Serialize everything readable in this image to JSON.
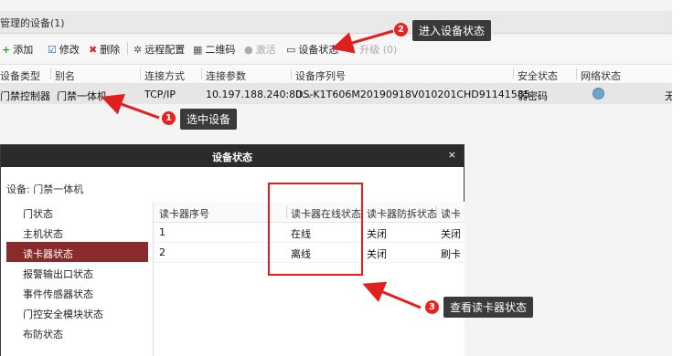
{
  "manager": {
    "title": "管理的设备(1)",
    "toolbar": [
      {
        "label": "添加",
        "icon": "plus-icon",
        "color": "#2e9e3a"
      },
      {
        "label": "修改",
        "icon": "edit-icon",
        "color": "#2a6fbf"
      },
      {
        "label": "删除",
        "icon": "delete-icon",
        "color": "#d62b2b"
      },
      {
        "label": "远程配置",
        "icon": "gear-icon",
        "color": "#555555"
      },
      {
        "label": "二维码",
        "icon": "qrcode-icon",
        "color": "#555555"
      },
      {
        "label": "激活",
        "icon": "activate-icon",
        "disabled": true
      },
      {
        "label": "设备状态",
        "icon": "device-status-icon",
        "color": "#333333"
      },
      {
        "label": "升级 (0)",
        "icon": "upgrade-icon",
        "disabled": true
      }
    ],
    "columns": [
      "设备类型",
      "别名",
      "连接方式",
      "连接参数",
      "设备序列号",
      "安全状态",
      "网络状态"
    ],
    "row": {
      "device_type": "门禁控制器",
      "alias": "门禁一体机",
      "connection": "TCP/IP",
      "params": "10.197.188.240:80...",
      "serial": "DS-K1T606M20190918V010201CHD91141585",
      "security": "弱密码",
      "network_icon": "globe-icon",
      "extra": "无"
    }
  },
  "dialog": {
    "title": "设备状态",
    "close": "×",
    "device_label": "设备: 门禁一体机",
    "sidebar": [
      "门状态",
      "主机状态",
      "读卡器状态",
      "报警输出口状态",
      "事件传感器状态",
      "门控安全模块状态",
      "布防状态"
    ],
    "active_index": 2,
    "columns": [
      "读卡器序号",
      "读卡器在线状态",
      "读卡器防拆状态",
      "读卡"
    ],
    "rows": [
      [
        "1",
        "在线",
        "关闭",
        "关闭"
      ],
      [
        "2",
        "离线",
        "关闭",
        "刷卡"
      ]
    ]
  },
  "annotations": [
    {
      "number": "1",
      "text": "选中设备"
    },
    {
      "number": "2",
      "text": "进入设备状态"
    },
    {
      "number": "3",
      "text": "查看读卡器状态"
    }
  ],
  "colors": {
    "accent_red": "#e21f1f",
    "active_item": "#8b2a2a",
    "dialog_header": "#2b2b2b"
  }
}
